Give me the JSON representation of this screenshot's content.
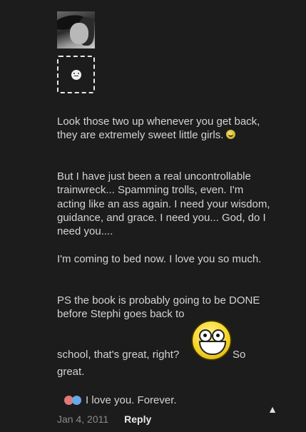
{
  "post": {
    "paragraphs": [
      "Look those two up whenever you get back, they are extremely sweet little girls.",
      "But I have just been a real uncontrollable trainwreck... Spamming trolls, even. I'm acting like an ass again. I need your wisdom, guidance, and grace. I need you... God, do I need you....",
      "I'm coming to bed now. I love you so much.",
      "PS the book is probably going to be DONE before Stephi goes back to",
      "school, that's great, right?",
      "So",
      "great.",
      "I love you. Forever."
    ],
    "icons": {
      "avatar": "profile-photo",
      "placeholder": "smiley-placeholder-icon",
      "small_emoji": "grin-emoji-icon",
      "epic_emoji": "epic-smiley-icon",
      "hearts": "hearts-icon",
      "scroll": "scroll-to-top-icon"
    }
  },
  "footer": {
    "date": "Jan 4, 2011",
    "reply_label": "Reply",
    "scroll_glyph": "▲"
  }
}
